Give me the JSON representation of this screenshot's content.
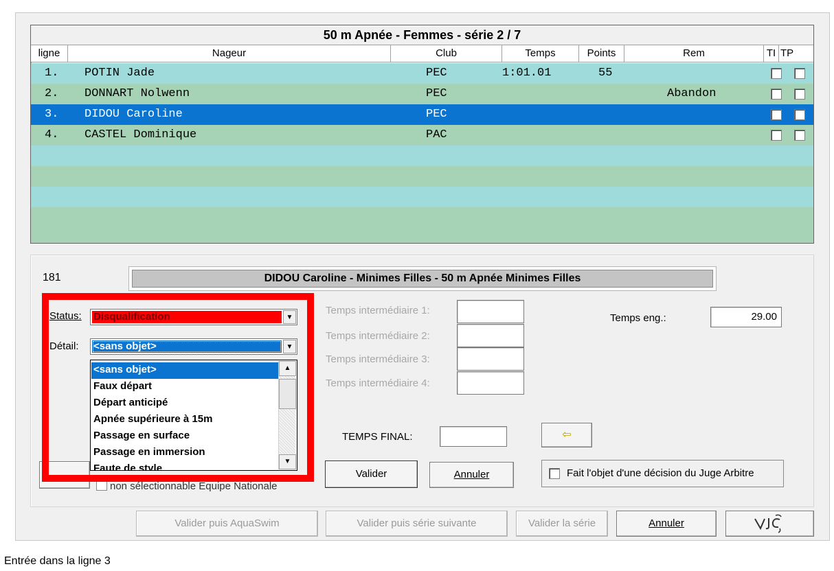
{
  "grid": {
    "title": "50 m Apnée  -  Femmes  -  série 2 / 7",
    "headers": [
      "ligne",
      "Nageur",
      "Club",
      "Temps",
      "Points",
      "Rem",
      "TI",
      "TP"
    ],
    "rows": [
      {
        "ligne": "1.",
        "nageur": "POTIN Jade",
        "club": "PEC",
        "temps": "1:01.01",
        "points": "55",
        "rem": ""
      },
      {
        "ligne": "2.",
        "nageur": "DONNART Nolwenn",
        "club": "PEC",
        "temps": "",
        "points": "",
        "rem": "Abandon"
      },
      {
        "ligne": "3.",
        "nageur": "DIDOU Caroline",
        "club": "PEC",
        "temps": "",
        "points": "",
        "rem": ""
      },
      {
        "ligne": "4.",
        "nageur": "CASTEL Dominique",
        "club": "PAC",
        "temps": "",
        "points": "",
        "rem": ""
      }
    ]
  },
  "details": {
    "id_number": "181",
    "title": "DIDOU Caroline  -  Minimes Filles  -  50 m Apnée Minimes Filles",
    "status_label": "Status:",
    "status_value": "Disqualification",
    "detail_label": "Détail:",
    "detail_value": "<sans objet>",
    "dropdown_options": [
      "<sans objet>",
      "Faux départ",
      "Départ anticipé",
      "Apnée supérieure à 15m",
      "Passage en surface",
      "Passage en immersion",
      "Faute de style"
    ],
    "ti1_label": "Temps intermédiaire 1:",
    "ti2_label": "Temps intermédiaire 2:",
    "ti3_label": "Temps intermédiaire 3:",
    "ti4_label": "Temps intermédiaire 4:",
    "temps_eng_label": "Temps eng.:",
    "temps_eng_value": "29.00",
    "temps_final_label": "TEMPS FINAL:",
    "valider_label": "Valider",
    "annuler_label": "Annuler",
    "juge_label": "Fait l'objet d'une décision du Juge Arbitre",
    "non_selectionnable_label": "non sélectionnable Equipe Nationale"
  },
  "footer": {
    "valider_aquaswim": "Valider puis AquaSwim",
    "valider_serie_suivante": "Valider puis série suivante",
    "valider_la_serie": "Valider la série",
    "annuler": "Annuler"
  },
  "status_bar": "Entrée dans la ligne 3",
  "colors": {
    "row_cyan": "#9edbda",
    "row_green": "#a6d3b5",
    "row_selected": "#0a74d0",
    "status_red": "#ff0000"
  }
}
